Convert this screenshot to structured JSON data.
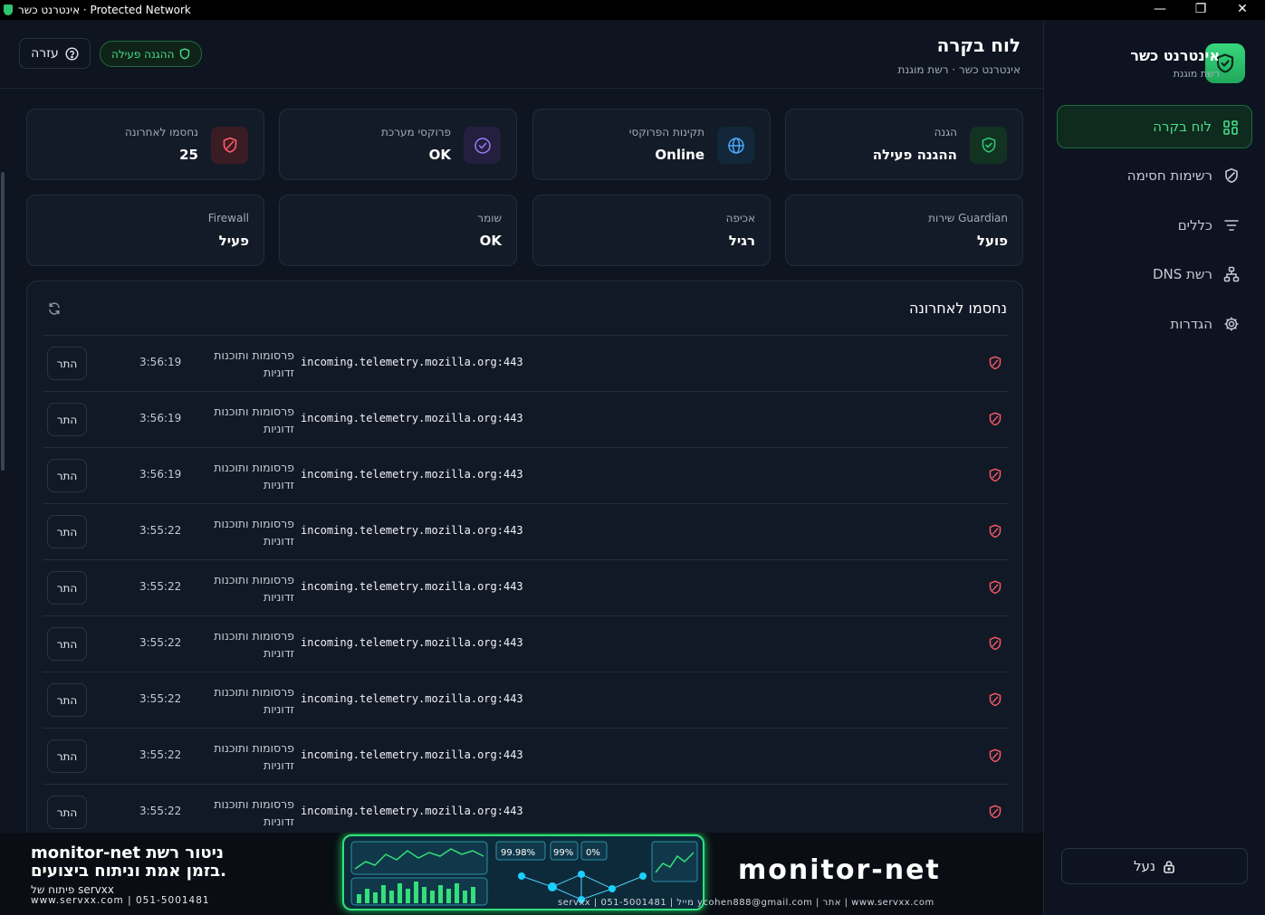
{
  "window": {
    "title": "אינטרנט כשר · Protected Network",
    "minimize": "—",
    "maximize": "❐",
    "close": "✕"
  },
  "brand": {
    "name": "אינטרנט כשר",
    "subtitle": "רשת מוגנת"
  },
  "nav": [
    {
      "label": "לוח בקרה",
      "icon": "dashboard-grid-icon",
      "active": true
    },
    {
      "label": "רשימות חסימה",
      "icon": "shield-icon",
      "active": false
    },
    {
      "label": "כללים",
      "icon": "filter-icon",
      "active": false
    },
    {
      "label": "DNS רשת",
      "icon": "network-icon",
      "active": false
    },
    {
      "label": "הגדרות",
      "icon": "gear-icon",
      "active": false
    }
  ],
  "lock_button": "נעל",
  "header": {
    "title": "לוח בקרה",
    "breadcrumb": "אינטרנט כשר · רשת מוגנת",
    "status_pill": "ההגנה פעילה",
    "help": "עזרה"
  },
  "cards_top": [
    {
      "label": "הגנה",
      "value": "ההגנה פעילה",
      "icon": "shield-check-icon",
      "accent": "#2fc46f"
    },
    {
      "label": "תקינות הפרוקסי",
      "value": "Online",
      "icon": "globe-icon",
      "accent": "#4aa8ff"
    },
    {
      "label": "פרוקסי מערכת",
      "value": "OK",
      "icon": "check-circle-icon",
      "accent": "#9b7cff"
    },
    {
      "label": "נחסמו לאחרונה",
      "value": "25",
      "icon": "blocked-shield-icon",
      "accent": "#ff5a6a"
    }
  ],
  "cards_bottom": [
    {
      "label": "שירות Guardian",
      "value": "פועל"
    },
    {
      "label": "אכיפה",
      "value": "רגיל"
    },
    {
      "label": "שומר",
      "value": "OK"
    },
    {
      "label": "Firewall",
      "value": "פעיל"
    }
  ],
  "panel": {
    "title": "נחסמו לאחרונה",
    "rows": [
      {
        "host": "incoming.telemetry.mozilla.org:443",
        "category": "פרסומות ותוכנות זדוניות",
        "time": "3:56:19",
        "action": "התר"
      },
      {
        "host": "incoming.telemetry.mozilla.org:443",
        "category": "פרסומות ותוכנות זדוניות",
        "time": "3:56:19",
        "action": "התר"
      },
      {
        "host": "incoming.telemetry.mozilla.org:443",
        "category": "פרסומות ותוכנות זדוניות",
        "time": "3:56:19",
        "action": "התר"
      },
      {
        "host": "incoming.telemetry.mozilla.org:443",
        "category": "פרסומות ותוכנות זדוניות",
        "time": "3:55:22",
        "action": "התר"
      },
      {
        "host": "incoming.telemetry.mozilla.org:443",
        "category": "פרסומות ותוכנות זדוניות",
        "time": "3:55:22",
        "action": "התר"
      },
      {
        "host": "incoming.telemetry.mozilla.org:443",
        "category": "פרסומות ותוכנות זדוניות",
        "time": "3:55:22",
        "action": "התר"
      },
      {
        "host": "incoming.telemetry.mozilla.org:443",
        "category": "פרסומות ותוכנות זדוניות",
        "time": "3:55:22",
        "action": "התר"
      },
      {
        "host": "incoming.telemetry.mozilla.org:443",
        "category": "פרסומות ותוכנות זדוניות",
        "time": "3:55:22",
        "action": "התר"
      },
      {
        "host": "incoming.telemetry.mozilla.org:443",
        "category": "פרסומות ותוכנות זדוניות",
        "time": "3:55:22",
        "action": "התר"
      }
    ]
  },
  "banner": {
    "line1": "monitor-net ניטור רשת",
    "line2": "בזמן אמת וניתוח ביצועים.",
    "line3": "פיתוח של servxx",
    "line4": "www.servxx.com | 051-5001481",
    "brand": "monitor-net",
    "contact": "servxx | 051-5001481 | מייל ycohen888@gmail.com | אתר | www.servxx.com",
    "dash_readouts": [
      "99.98%",
      "99%",
      "0%"
    ]
  }
}
